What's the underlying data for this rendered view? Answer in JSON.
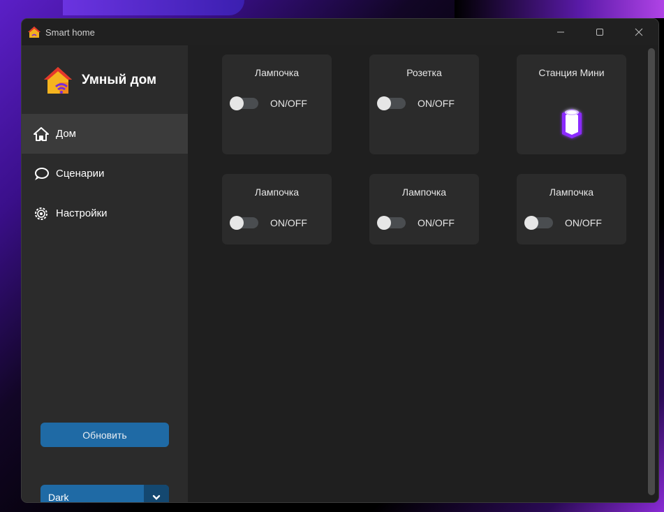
{
  "window": {
    "title": "Smart home",
    "controls": [
      "minimize-icon",
      "maximize-icon",
      "close-icon"
    ]
  },
  "sidebar": {
    "brand": "Умный дом",
    "nav": [
      {
        "label": "Дом",
        "icon": "home-icon",
        "active": true
      },
      {
        "label": "Сценарии",
        "icon": "chat-bubble-icon",
        "active": false
      },
      {
        "label": "Настройки",
        "icon": "gear-icon",
        "active": false
      }
    ],
    "update_button": "Обновить",
    "theme": {
      "selected": "Dark"
    }
  },
  "devices": [
    {
      "name": "Лампочка",
      "toggle_label": "ON/OFF",
      "state": false
    },
    {
      "name": "Розетка",
      "toggle_label": "ON/OFF",
      "state": false
    },
    {
      "name": "Станция Мини",
      "icon": "smart-speaker-icon"
    },
    {
      "name": "Лампочка",
      "toggle_label": "ON/OFF",
      "state": false
    },
    {
      "name": "Лампочка",
      "toggle_label": "ON/OFF",
      "state": false
    },
    {
      "name": "Лампочка",
      "toggle_label": "ON/OFF",
      "state": false
    }
  ],
  "colors": {
    "accent": "#1f6aa5",
    "accent_dark": "#144870",
    "sidebar_bg": "#2b2b2b",
    "main_bg": "#1f1f1f",
    "card_bg": "#2b2b2b",
    "station_glow": "#8b2cff"
  }
}
